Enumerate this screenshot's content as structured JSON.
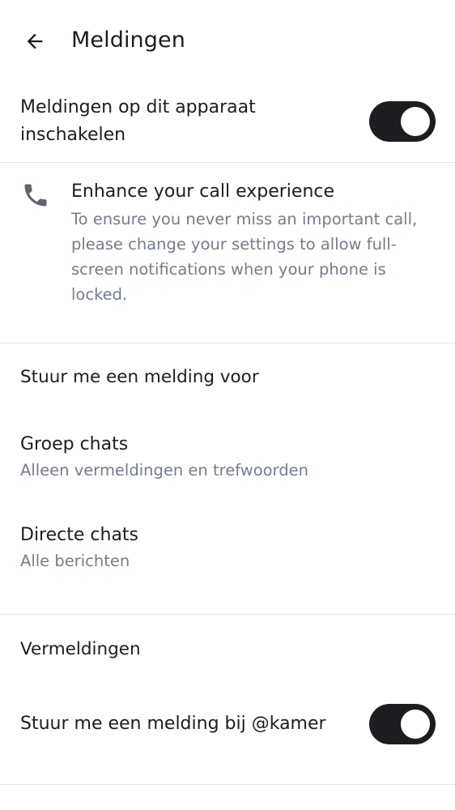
{
  "header": {
    "title": "Meldingen",
    "back_icon": "arrow-back-icon"
  },
  "master_toggle": {
    "label": "Meldingen op dit apparaat inschakelen",
    "enabled": true
  },
  "call_card": {
    "icon": "phone-icon",
    "title": "Enhance your call experience",
    "description": "To ensure you never miss an important call, please change your settings to allow full-screen notifications when your phone is locked."
  },
  "notify_section": {
    "header": "Stuur me een melding voor",
    "items": [
      {
        "title": "Groep chats",
        "subtitle": "Alleen vermeldingen en trefwoorden"
      },
      {
        "title": "Directe chats",
        "subtitle": "Alle berichten"
      }
    ]
  },
  "mentions_section": {
    "header": "Vermeldingen",
    "toggle_label": "Stuur me een melding bij @kamer",
    "enabled": true
  },
  "colors": {
    "text_primary": "#1b1d21",
    "text_secondary": "#737d8c",
    "toggle_on": "#1b1d21",
    "divider": "#e4e6ea"
  }
}
